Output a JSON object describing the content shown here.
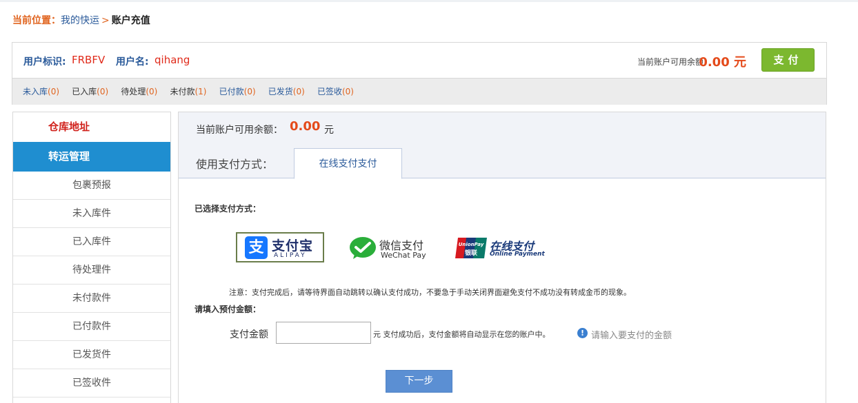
{
  "breadcrumb": {
    "label": "当前位置：",
    "link": "我的快运",
    "separator": ">",
    "current": "账户充值"
  },
  "user": {
    "id_label": "用户标识:",
    "id_value": "FRBFV",
    "name_label": "用户名:",
    "name_value": "qihang",
    "balance_label": "当前账户可用余额",
    "balance_value": "0.00 元",
    "pay_button": "支付"
  },
  "status_items": [
    {
      "name": "未入库",
      "count": "(0)"
    },
    {
      "name": "已入库",
      "count": "(0)"
    },
    {
      "name": "待处理",
      "count": "(0)"
    },
    {
      "name": "未付款",
      "count": "(1)"
    },
    {
      "name": "已付款",
      "count": "(0)"
    },
    {
      "name": "已发货",
      "count": "(0)"
    },
    {
      "name": "已签收",
      "count": "(0)"
    }
  ],
  "sidebar": {
    "warehouse": "仓库地址",
    "transport": "转运管理",
    "items": [
      "包裹预报",
      "未入库件",
      "已入库件",
      "待处理件",
      "未付款件",
      "已付款件",
      "已发货件",
      "已签收件"
    ]
  },
  "main": {
    "avail_label": "当前账户可用余额：",
    "avail_value": "0.00",
    "avail_unit": "元",
    "method_label": "使用支付方式：",
    "tab_label": "在线支付支付",
    "selected_label": "已选择支付方式：",
    "alipay": {
      "icon": "支",
      "cn": "支付宝",
      "en": "ALIPAY"
    },
    "wechat": {
      "cn": "微信支付",
      "en": "WeChat Pay"
    },
    "unionpay": {
      "badge_top": "UnionPay",
      "badge_bottom": "银联",
      "cn": "在线支付",
      "en": "Online Payment"
    },
    "notice": "注意：支付完成后，请等待界面自动跳转以确认支付成功，不要急于手动关闭界面避免支付不成功没有转成金币的现象。",
    "fill_label": "请填入预付金额：",
    "amount_label": "支付金额",
    "amount_value": "",
    "amount_hint": "元 支付成功后，支付金额将自动显示在您的账户中。",
    "info_text": "请输入要支付的金额",
    "next_button": "下一步"
  },
  "colors": {
    "accent_orange": "#e0641f",
    "link_blue": "#2a5a9a",
    "pay_green": "#7cb82f",
    "sidebar_active": "#1f8ed0",
    "next_blue": "#5b8fd3"
  }
}
